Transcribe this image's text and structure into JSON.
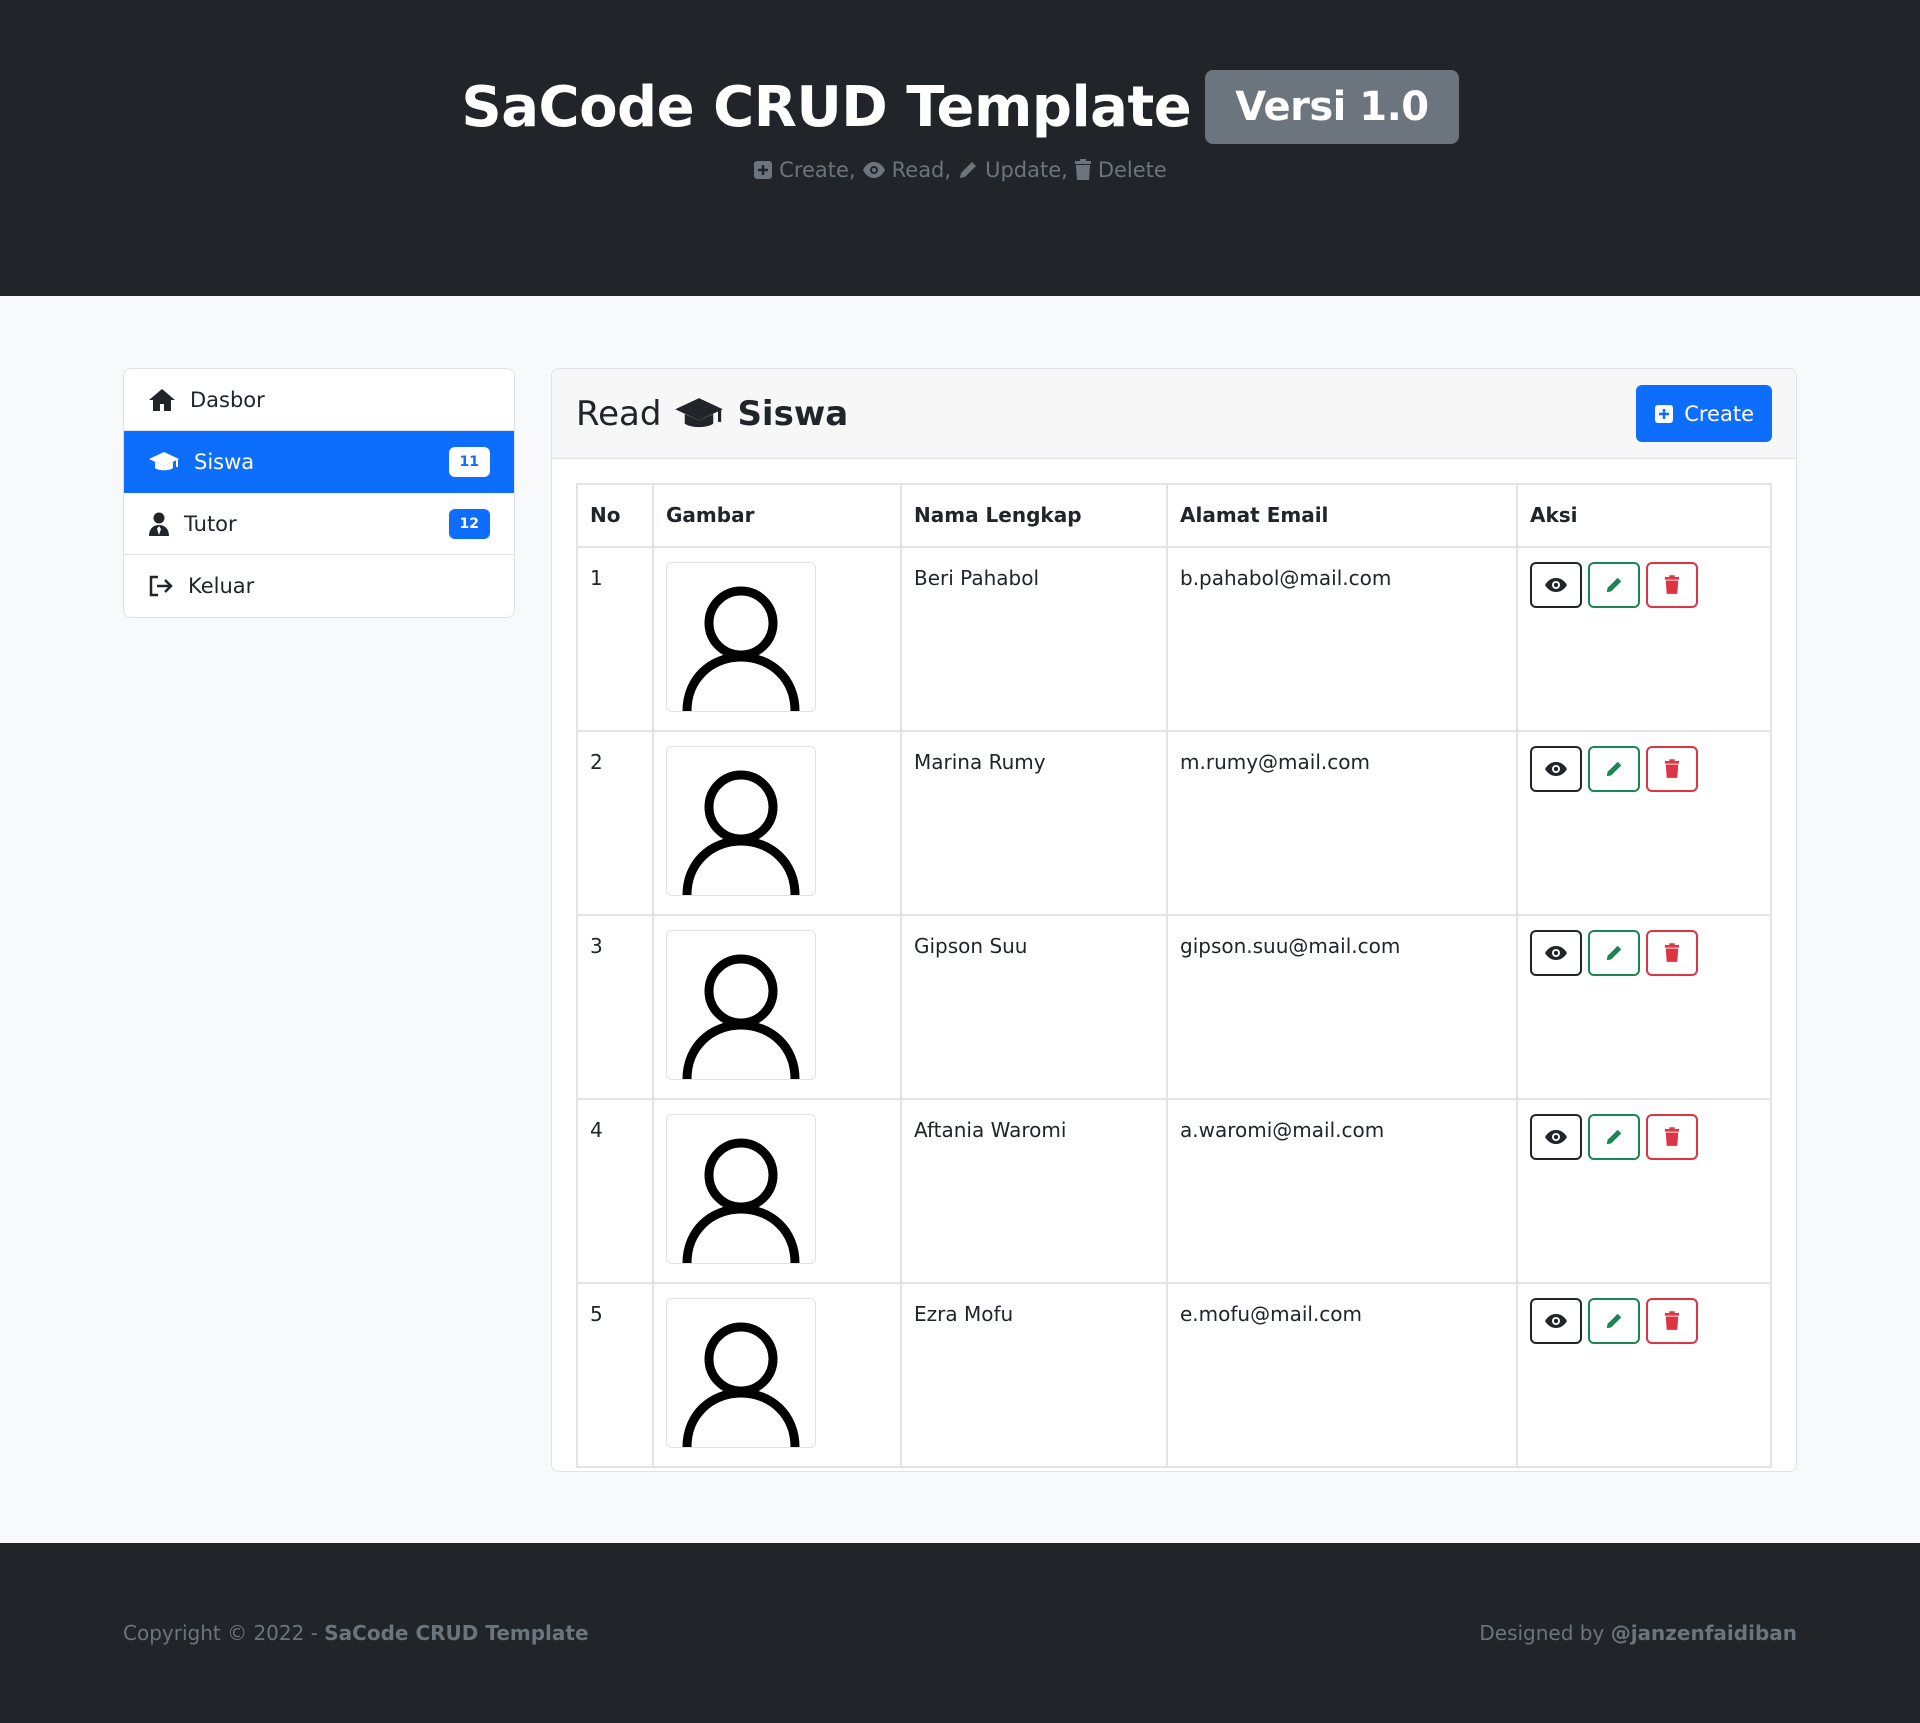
{
  "header": {
    "title": "SaCode CRUD Template",
    "version": "Versi 1.0",
    "ops": [
      "Create,",
      "Read,",
      "Update,",
      "Delete"
    ]
  },
  "sidebar": {
    "items": [
      {
        "label": "Dasbor",
        "icon": "house-icon"
      },
      {
        "label": "Siswa",
        "icon": "graduation-cap-icon",
        "badge": "11"
      },
      {
        "label": "Tutor",
        "icon": "user-tie-icon",
        "badge": "12"
      },
      {
        "label": "Keluar",
        "icon": "sign-out-icon"
      }
    ]
  },
  "card": {
    "title_prefix": "Read",
    "title_entity": "Siswa",
    "create_label": "Create"
  },
  "table": {
    "headers": [
      "No",
      "Gambar",
      "Nama Lengkap",
      "Alamat Email",
      "Aksi"
    ],
    "rows": [
      {
        "no": "1",
        "name": "Beri Pahabol",
        "email": "b.pahabol@mail.com"
      },
      {
        "no": "2",
        "name": "Marina Rumy",
        "email": "m.rumy@mail.com"
      },
      {
        "no": "3",
        "name": "Gipson Suu",
        "email": "gipson.suu@mail.com"
      },
      {
        "no": "4",
        "name": "Aftania Waromi",
        "email": "a.waromi@mail.com"
      },
      {
        "no": "5",
        "name": "Ezra Mofu",
        "email": "e.mofu@mail.com"
      }
    ]
  },
  "footer": {
    "copyright_prefix": "Copyright © 2022 -",
    "copyright_brand": "SaCode CRUD Template",
    "designed_prefix": "Designed by",
    "designed_by": "@janzenfaidiban"
  },
  "colors": {
    "primary": "#0d6efd",
    "dark": "#212529",
    "muted": "#6c757d",
    "success": "#198754",
    "danger": "#dc3545"
  }
}
